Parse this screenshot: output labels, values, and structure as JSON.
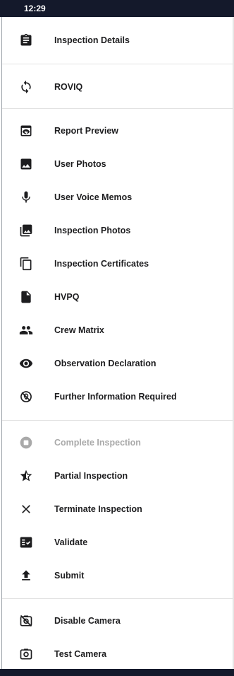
{
  "status_bar": {
    "time": "12:29"
  },
  "sections": [
    {
      "items": [
        {
          "label": "Inspection Details",
          "icon": "clipboard-icon",
          "enabled": true
        }
      ]
    },
    {
      "items": [
        {
          "label": "ROVIQ",
          "icon": "sync-icon",
          "enabled": true
        }
      ]
    },
    {
      "items": [
        {
          "label": "Report Preview",
          "icon": "preview-icon",
          "enabled": true
        },
        {
          "label": "User Photos",
          "icon": "image-icon",
          "enabled": true
        },
        {
          "label": "User Voice Memos",
          "icon": "microphone-icon",
          "enabled": true
        },
        {
          "label": "Inspection Photos",
          "icon": "photo-library-icon",
          "enabled": true
        },
        {
          "label": "Inspection Certificates",
          "icon": "copy-icon",
          "enabled": true
        },
        {
          "label": "HVPQ",
          "icon": "document-icon",
          "enabled": true
        },
        {
          "label": "Crew Matrix",
          "icon": "people-icon",
          "enabled": true
        },
        {
          "label": "Observation Declaration",
          "icon": "eye-icon",
          "enabled": true
        },
        {
          "label": "Further Information Required",
          "icon": "location-off-icon",
          "enabled": true
        }
      ]
    },
    {
      "items": [
        {
          "label": "Complete Inspection",
          "icon": "stop-circle-icon",
          "enabled": false
        },
        {
          "label": "Partial Inspection",
          "icon": "half-star-icon",
          "enabled": true
        },
        {
          "label": "Terminate Inspection",
          "icon": "close-icon",
          "enabled": true
        },
        {
          "label": "Validate",
          "icon": "fact-check-icon",
          "enabled": true
        },
        {
          "label": "Submit",
          "icon": "upload-icon",
          "enabled": true
        }
      ]
    },
    {
      "items": [
        {
          "label": "Disable Camera",
          "icon": "no-camera-icon",
          "enabled": true
        },
        {
          "label": "Test Camera",
          "icon": "camera-icon",
          "enabled": true
        }
      ]
    }
  ],
  "colors": {
    "status_bar": "#14192b",
    "text": "#1d1d1f",
    "disabled_text": "#a9a9a9",
    "icon": "#1d1d1f",
    "disabled_icon": "#a9a9a9"
  }
}
